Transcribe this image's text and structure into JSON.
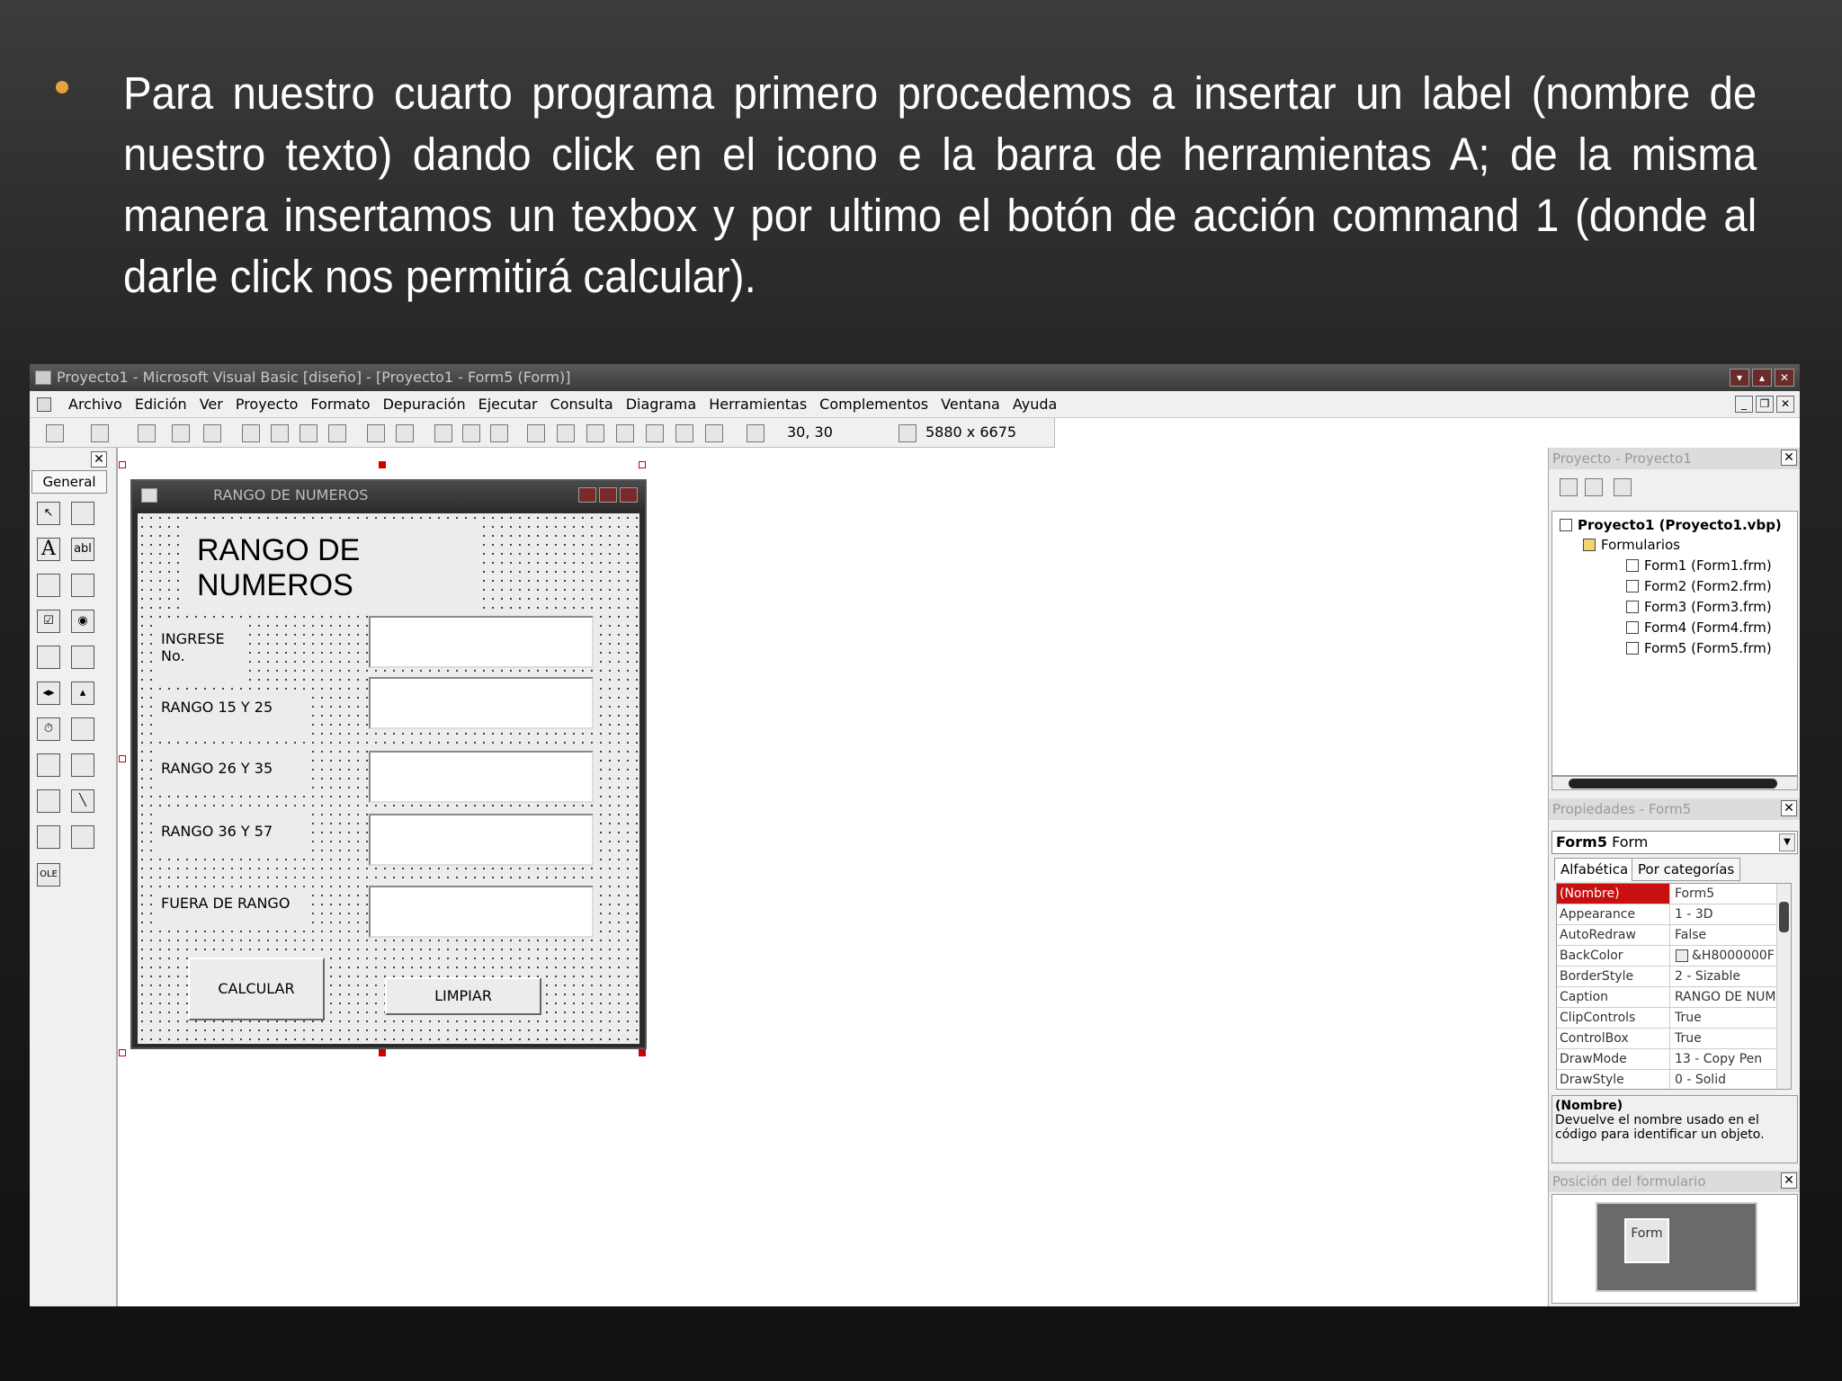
{
  "slide": {
    "text": "Para nuestro cuarto programa primero procedemos a insertar un label (nombre de nuestro texto) dando click en el icono e la barra de herramientas A; de la misma manera insertamos un texbox y por ultimo el botón de acción command 1 (donde al darle click nos permitirá calcular)."
  },
  "window": {
    "title": "Proyecto1 - Microsoft Visual Basic [diseño] - [Proyecto1 - Form5 (Form)]"
  },
  "menu": [
    "Archivo",
    "Edición",
    "Ver",
    "Proyecto",
    "Formato",
    "Depuración",
    "Ejecutar",
    "Consulta",
    "Diagrama",
    "Herramientas",
    "Complementos",
    "Ventana",
    "Ayuda"
  ],
  "toolbar": {
    "position": "30, 30",
    "size": "5880 x 6675"
  },
  "toolbox": {
    "tab": "General",
    "close": "✕",
    "icons": [
      "pointer-icon",
      "picturebox-icon",
      "label-icon",
      "textbox-icon",
      "frame-icon",
      "commandbutton-icon",
      "checkbox-icon",
      "optionbutton-icon",
      "combobox-icon",
      "listbox-icon",
      "hscrollbar-icon",
      "vscrollbar-icon",
      "timer-icon",
      "drivelistbox-icon",
      "dirlistbox-icon",
      "filelistbox-icon",
      "shape-icon",
      "line-icon",
      "image-icon",
      "data-icon",
      "ole-icon"
    ],
    "label_glyph": "A",
    "textbox_glyph": "abl",
    "ole_glyph": "OLE"
  },
  "form": {
    "caption": "RANGO DE NUMEROS",
    "heading": "RANGO DE NUMEROS",
    "labels": [
      "INGRESE No.",
      "RANGO 15 Y 25",
      "RANGO 26 Y 35",
      "RANGO 36 Y 57",
      "FUERA DE RANGO"
    ],
    "buttons": {
      "calc": "CALCULAR",
      "clear": "LIMPIAR"
    }
  },
  "project": {
    "title": "Proyecto - Proyecto1",
    "root": "Proyecto1 (Proyecto1.vbp)",
    "folder": "Formularios",
    "forms": [
      "Form1 (Form1.frm)",
      "Form2 (Form2.frm)",
      "Form3 (Form3.frm)",
      "Form4 (Form4.frm)",
      "Form5 (Form5.frm)"
    ]
  },
  "properties": {
    "title": "Propiedades - Form5",
    "object": "Form5",
    "object_type": "Form",
    "tabs": [
      "Alfabética",
      "Por categorías"
    ],
    "rows": [
      {
        "k": "(Nombre)",
        "v": "Form5"
      },
      {
        "k": "Appearance",
        "v": "1 - 3D"
      },
      {
        "k": "AutoRedraw",
        "v": "False"
      },
      {
        "k": "BackColor",
        "v": "&H8000000F"
      },
      {
        "k": "BorderStyle",
        "v": "2 - Sizable"
      },
      {
        "k": "Caption",
        "v": "RANGO DE NUMI"
      },
      {
        "k": "ClipControls",
        "v": "True"
      },
      {
        "k": "ControlBox",
        "v": "True"
      },
      {
        "k": "DrawMode",
        "v": "13 - Copy Pen"
      },
      {
        "k": "DrawStyle",
        "v": "0 - Solid"
      }
    ],
    "desc_title": "(Nombre)",
    "desc_text": "Devuelve el nombre usado en el código para identificar un objeto."
  },
  "position": {
    "title": "Posición del formulario",
    "mini": "Form"
  },
  "colors": {
    "accent": "#e6a23c",
    "selected": "#c81010"
  }
}
